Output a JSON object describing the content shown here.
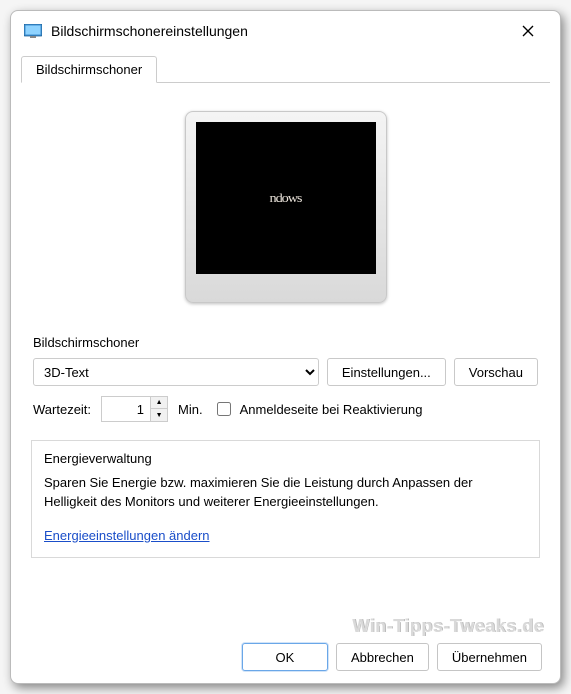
{
  "title": "Bildschirmschonereinstellungen",
  "tab": {
    "label": "Bildschirmschoner"
  },
  "preview": {
    "text": "ndows"
  },
  "screensaver": {
    "group_label": "Bildschirmschoner",
    "selected": "3D-Text",
    "settings_btn": "Einstellungen...",
    "preview_btn": "Vorschau",
    "wait_label": "Wartezeit:",
    "wait_value": "1",
    "wait_unit": "Min.",
    "resume_checkbox_label": "Anmeldeseite bei Reaktivierung"
  },
  "energy": {
    "group_label": "Energieverwaltung",
    "description": "Sparen Sie Energie bzw. maximieren Sie die Leistung durch Anpassen der Helligkeit des Monitors und weiterer Energieeinstellungen.",
    "link_label": "Energieeinstellungen ändern"
  },
  "footer": {
    "ok": "OK",
    "cancel": "Abbrechen",
    "apply": "Übernehmen"
  },
  "watermark": "Win-Tipps-Tweaks.de"
}
